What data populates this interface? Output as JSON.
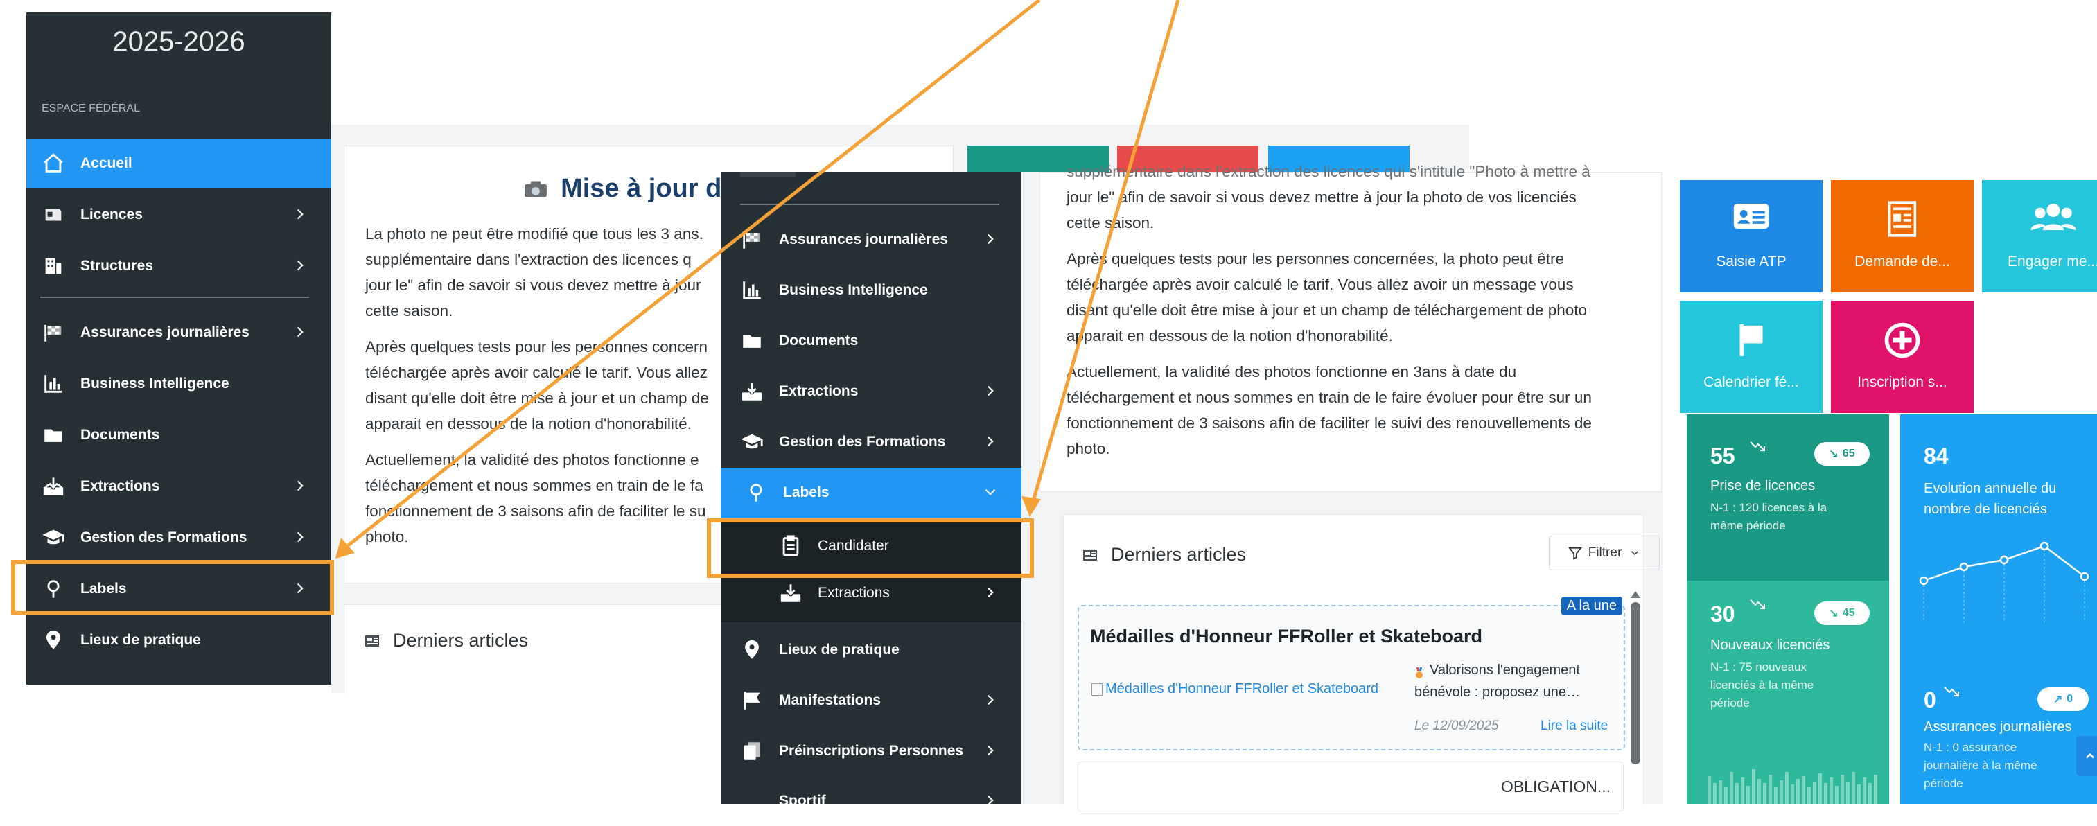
{
  "colors": {
    "sidebar_bg": "#273035",
    "sidebar_active": "#2196f3",
    "submenu_bg": "#1c2327",
    "highlight_orange": "#f4a238",
    "title_blue": "#1b3f6b",
    "teal": "#1a9a84",
    "cyan": "#25c6db",
    "orange": "#f06a00",
    "pink": "#e0136b",
    "blue_card": "#1da1f2"
  },
  "left_sidebar": {
    "year": "2025-2026",
    "section": "ESPACE FÉDÉRAL",
    "items": [
      {
        "label": "Accueil",
        "icon": "home-icon"
      },
      {
        "label": "Licences",
        "icon": "id-card-icon"
      },
      {
        "label": "Structures",
        "icon": "building-icon"
      },
      {
        "label": "Assurances journalières",
        "icon": "flag-checkered-icon"
      },
      {
        "label": "Business Intelligence",
        "icon": "bar-chart-icon"
      },
      {
        "label": "Documents",
        "icon": "folder-icon"
      },
      {
        "label": "Extractions",
        "icon": "download-tray-icon"
      },
      {
        "label": "Gestion des Formations",
        "icon": "graduation-cap-icon"
      },
      {
        "label": "Labels",
        "icon": "award-icon"
      },
      {
        "label": "Lieux de pratique",
        "icon": "map-pin-icon"
      }
    ]
  },
  "left_main": {
    "card_title": "Mise à jour des p",
    "paragraphs": [
      "La photo ne peut être modifié que tous les 3 ans.",
      "supplémentaire dans l'extraction des licences q",
      "jour le\" afin de savoir si vous devez mettre à jour",
      "cette saison.",
      "Après quelques tests pour les personnes concern",
      "téléchargée après avoir calculé le tarif. Vous allez",
      "disant qu'elle doit être mise à jour et un champ de",
      "apparait en dessous de la notion d'honorabilité.",
      "Actuellement, la validité des photos fonctionne e",
      "téléchargement et nous sommes en train de le fa",
      "fonctionnement de 3 saisons afin de faciliter le su",
      "photo."
    ],
    "articles_heading": "Derniers articles"
  },
  "right_sidebar": {
    "items": [
      {
        "label": "Assurances journalières",
        "icon": "flag-checkered-icon",
        "chevron": true
      },
      {
        "label": "Business Intelligence",
        "icon": "bar-chart-icon",
        "chevron": false
      },
      {
        "label": "Documents",
        "icon": "folder-icon",
        "chevron": false
      },
      {
        "label": "Extractions",
        "icon": "download-tray-icon",
        "chevron": true
      },
      {
        "label": "Gestion des Formations",
        "icon": "graduation-cap-icon",
        "chevron": true
      },
      {
        "label": "Labels",
        "icon": "award-icon",
        "chevron": true,
        "expanded": true
      },
      {
        "label": "Candidater",
        "icon": "clipboard-icon",
        "sub": true
      },
      {
        "label": "Extractions",
        "icon": "download-tray-icon",
        "sub": true,
        "chevron": true
      },
      {
        "label": "Lieux de pratique",
        "icon": "map-pin-icon",
        "chevron": false
      },
      {
        "label": "Manifestations",
        "icon": "flag-icon",
        "chevron": true
      },
      {
        "label": "Préinscriptions Personnes",
        "icon": "clipboard-copy-icon",
        "chevron": true
      },
      {
        "label": "Sportif",
        "icon": "",
        "chevron": true
      }
    ]
  },
  "right_main": {
    "paragraphs": [
      "supplémentaire dans l'extraction des licences qui s'intitule \"Photo à mettre à",
      "jour le\" afin de savoir si vous devez mettre à jour la photo de vos licenciés",
      "cette saison.",
      "Après quelques tests pour les personnes concernées, la photo peut être",
      "téléchargée après avoir calculé le tarif. Vous allez avoir un message vous",
      "disant qu'elle doit être mise à jour et un champ de téléchargement de photo",
      "apparait en dessous de la notion d'honorabilité.",
      "Actuellement, la validité des photos fonctionne en 3ans à date du",
      "téléchargement et nous sommes en train de le faire évoluer pour être sur un",
      "fonctionnement de 3 saisons afin de faciliter le suivi des renouvellements de",
      "photo."
    ],
    "articles_heading": "Derniers articles",
    "filter_label": "Filtrer",
    "badge": "A la une",
    "article_title": "Médailles d'Honneur FFRoller et Skateboard",
    "article_image_alt": "Médailles d'Honneur FFRoller et Skateboard",
    "article_excerpt_1": "Valorisons l'engagement",
    "article_excerpt_2": "bénévole : proposez une…",
    "article_date": "Le 12/09/2025",
    "read_more": "Lire la suite",
    "next_article": "OBLIGATION..."
  },
  "tiles": [
    {
      "label": "Saisie ATP",
      "icon": "id-card-icon",
      "color": "#1e88e5"
    },
    {
      "label": "Demande de...",
      "icon": "form-icon",
      "color": "#f06a00"
    },
    {
      "label": "Engager me...",
      "icon": "users-icon",
      "color": "#25c6db"
    },
    {
      "label": "Calendrier fé...",
      "icon": "flag-icon",
      "color": "#25c6db"
    },
    {
      "label": "Inscription s...",
      "icon": "plus-circle-icon",
      "color": "#e0136b"
    }
  ],
  "stats": {
    "licences": {
      "value": "55",
      "trend": "65",
      "title": "Prise de licences",
      "sub": [
        "N-1 : 120 licences à la",
        "même période"
      ]
    },
    "nouveaux": {
      "value": "30",
      "trend": "45",
      "title": "Nouveaux licenciés",
      "sub": [
        "N-1 : 75 nouveaux",
        "licenciés à la même",
        "période"
      ]
    },
    "evolution": {
      "value": "84",
      "title": [
        "Evolution annuelle du",
        "nombre de licenciés"
      ]
    },
    "assurances": {
      "value": "0",
      "trend": "0",
      "title": "Assurances journalières",
      "sub": [
        "N-1 : 0 assurance",
        "journalière à la même",
        "période"
      ]
    }
  }
}
